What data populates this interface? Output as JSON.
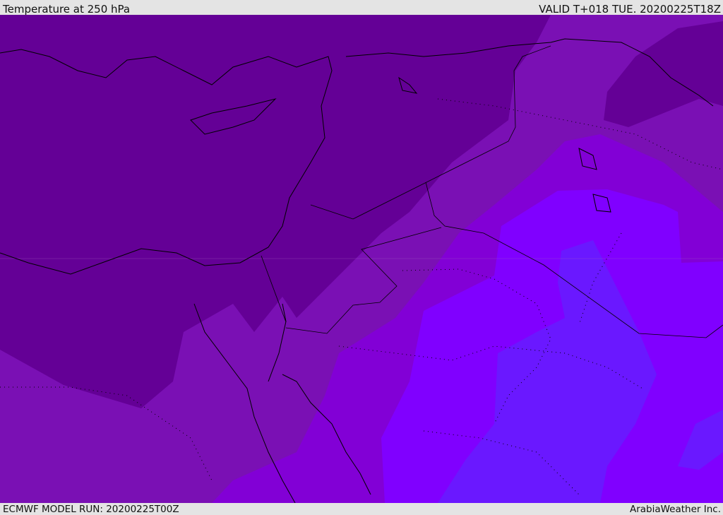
{
  "header": {
    "title": "Temperature at 250 hPa",
    "valid": "VALID T+018 TUE. 20200225T18Z"
  },
  "footer": {
    "model_run": "ECMWF MODEL RUN: 20200225T00Z",
    "credit": "ArabiaWeather Inc."
  },
  "colors": {
    "band_darkest": "#640096",
    "band_mid": "#7a10b4",
    "band_violet": "#8200d6",
    "band_bright": "#8000ff",
    "band_blue": "#6a18ff",
    "borders": "#000000",
    "background": "#e4e4e4"
  }
}
